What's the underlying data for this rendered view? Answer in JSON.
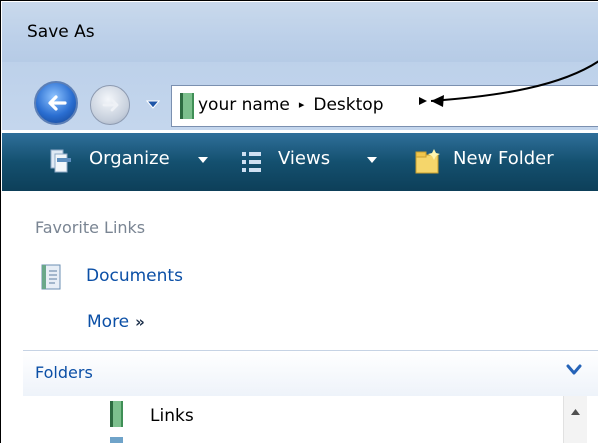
{
  "window": {
    "title": "Save As"
  },
  "nav": {
    "address": {
      "crumbs": [
        "your name",
        "Desktop"
      ],
      "separator": "▸"
    }
  },
  "toolbar": {
    "organize_label": "Organize",
    "views_label": "Views",
    "new_folder_label": "New Folder"
  },
  "left_pane": {
    "favorite_links_title": "Favorite Links",
    "links": [
      {
        "label": "Documents",
        "icon": "document-icon"
      }
    ],
    "more_label": "More",
    "more_glyph": "»"
  },
  "folders": {
    "label": "Folders",
    "tree": [
      {
        "label": "Links",
        "icon": "folder-icon"
      }
    ]
  },
  "colors": {
    "toolbar": "#14506f",
    "link": "#0b4fa6",
    "title_bar": "#c9d9ec"
  }
}
